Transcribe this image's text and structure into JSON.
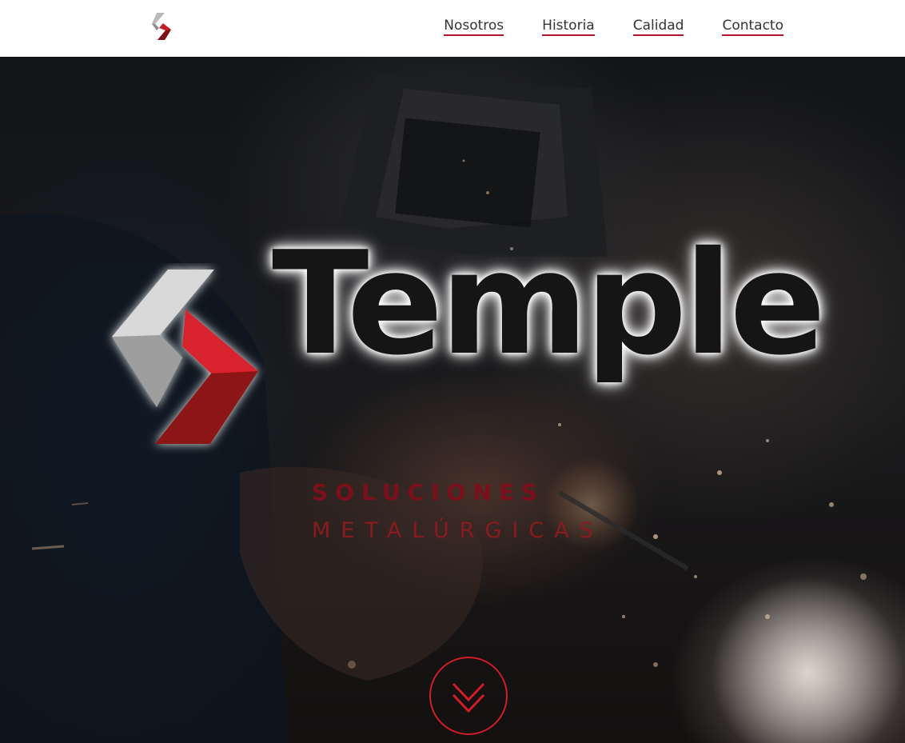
{
  "nav": {
    "links": [
      "Nosotros",
      "Historia",
      "Calidad",
      "Contacto"
    ]
  },
  "hero": {
    "wordmark": "Temple",
    "tagline_line1": "SOLUCIONES",
    "tagline_line2": "METALÚRGICAS"
  },
  "icons": {
    "nav_logo": "temple-logo-icon",
    "scroll": "double-chevron-down-icon"
  },
  "colors": {
    "brand_red": "#d21d29",
    "dark_red": "#7c0f1c",
    "logo_gray": "#d4d4d4"
  }
}
